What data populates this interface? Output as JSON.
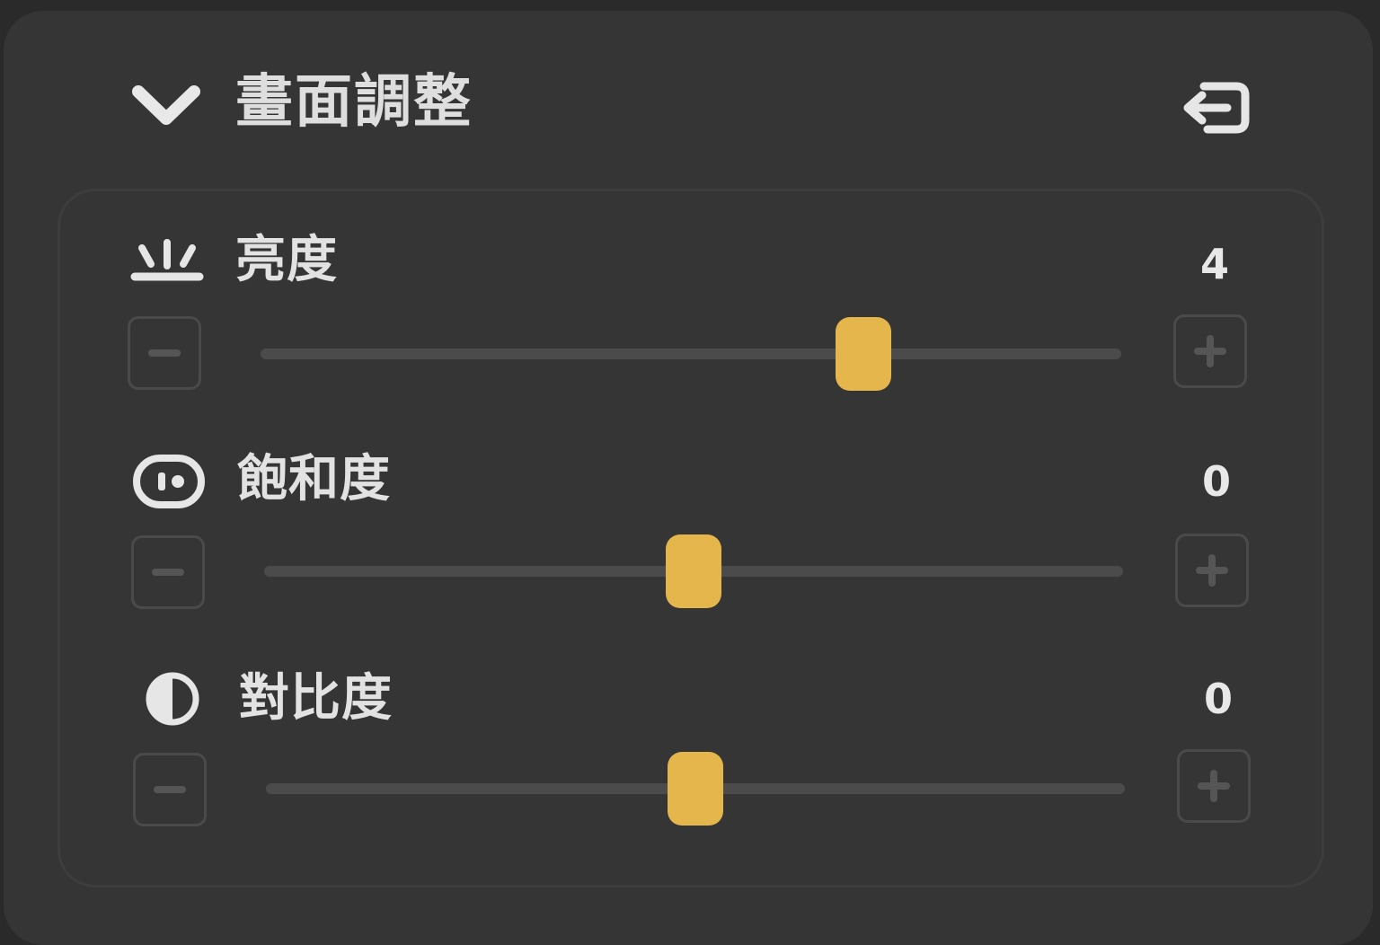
{
  "panel": {
    "title": "畫面調整"
  },
  "adjustments": [
    {
      "label": "亮度",
      "value": "4",
      "icon": "brightness-icon",
      "min": -10,
      "max": 10,
      "level": 4
    },
    {
      "label": "飽和度",
      "value": "0",
      "icon": "saturation-icon",
      "min": -10,
      "max": 10,
      "level": 0
    },
    {
      "label": "對比度",
      "value": "0",
      "icon": "contrast-icon",
      "min": -10,
      "max": 10,
      "level": 0
    }
  ],
  "colors": {
    "background": "#2a2a2a",
    "panel": "#353535",
    "accent": "#e4b64b",
    "track": "#4b4b4b",
    "text": "#e2e2e2"
  }
}
